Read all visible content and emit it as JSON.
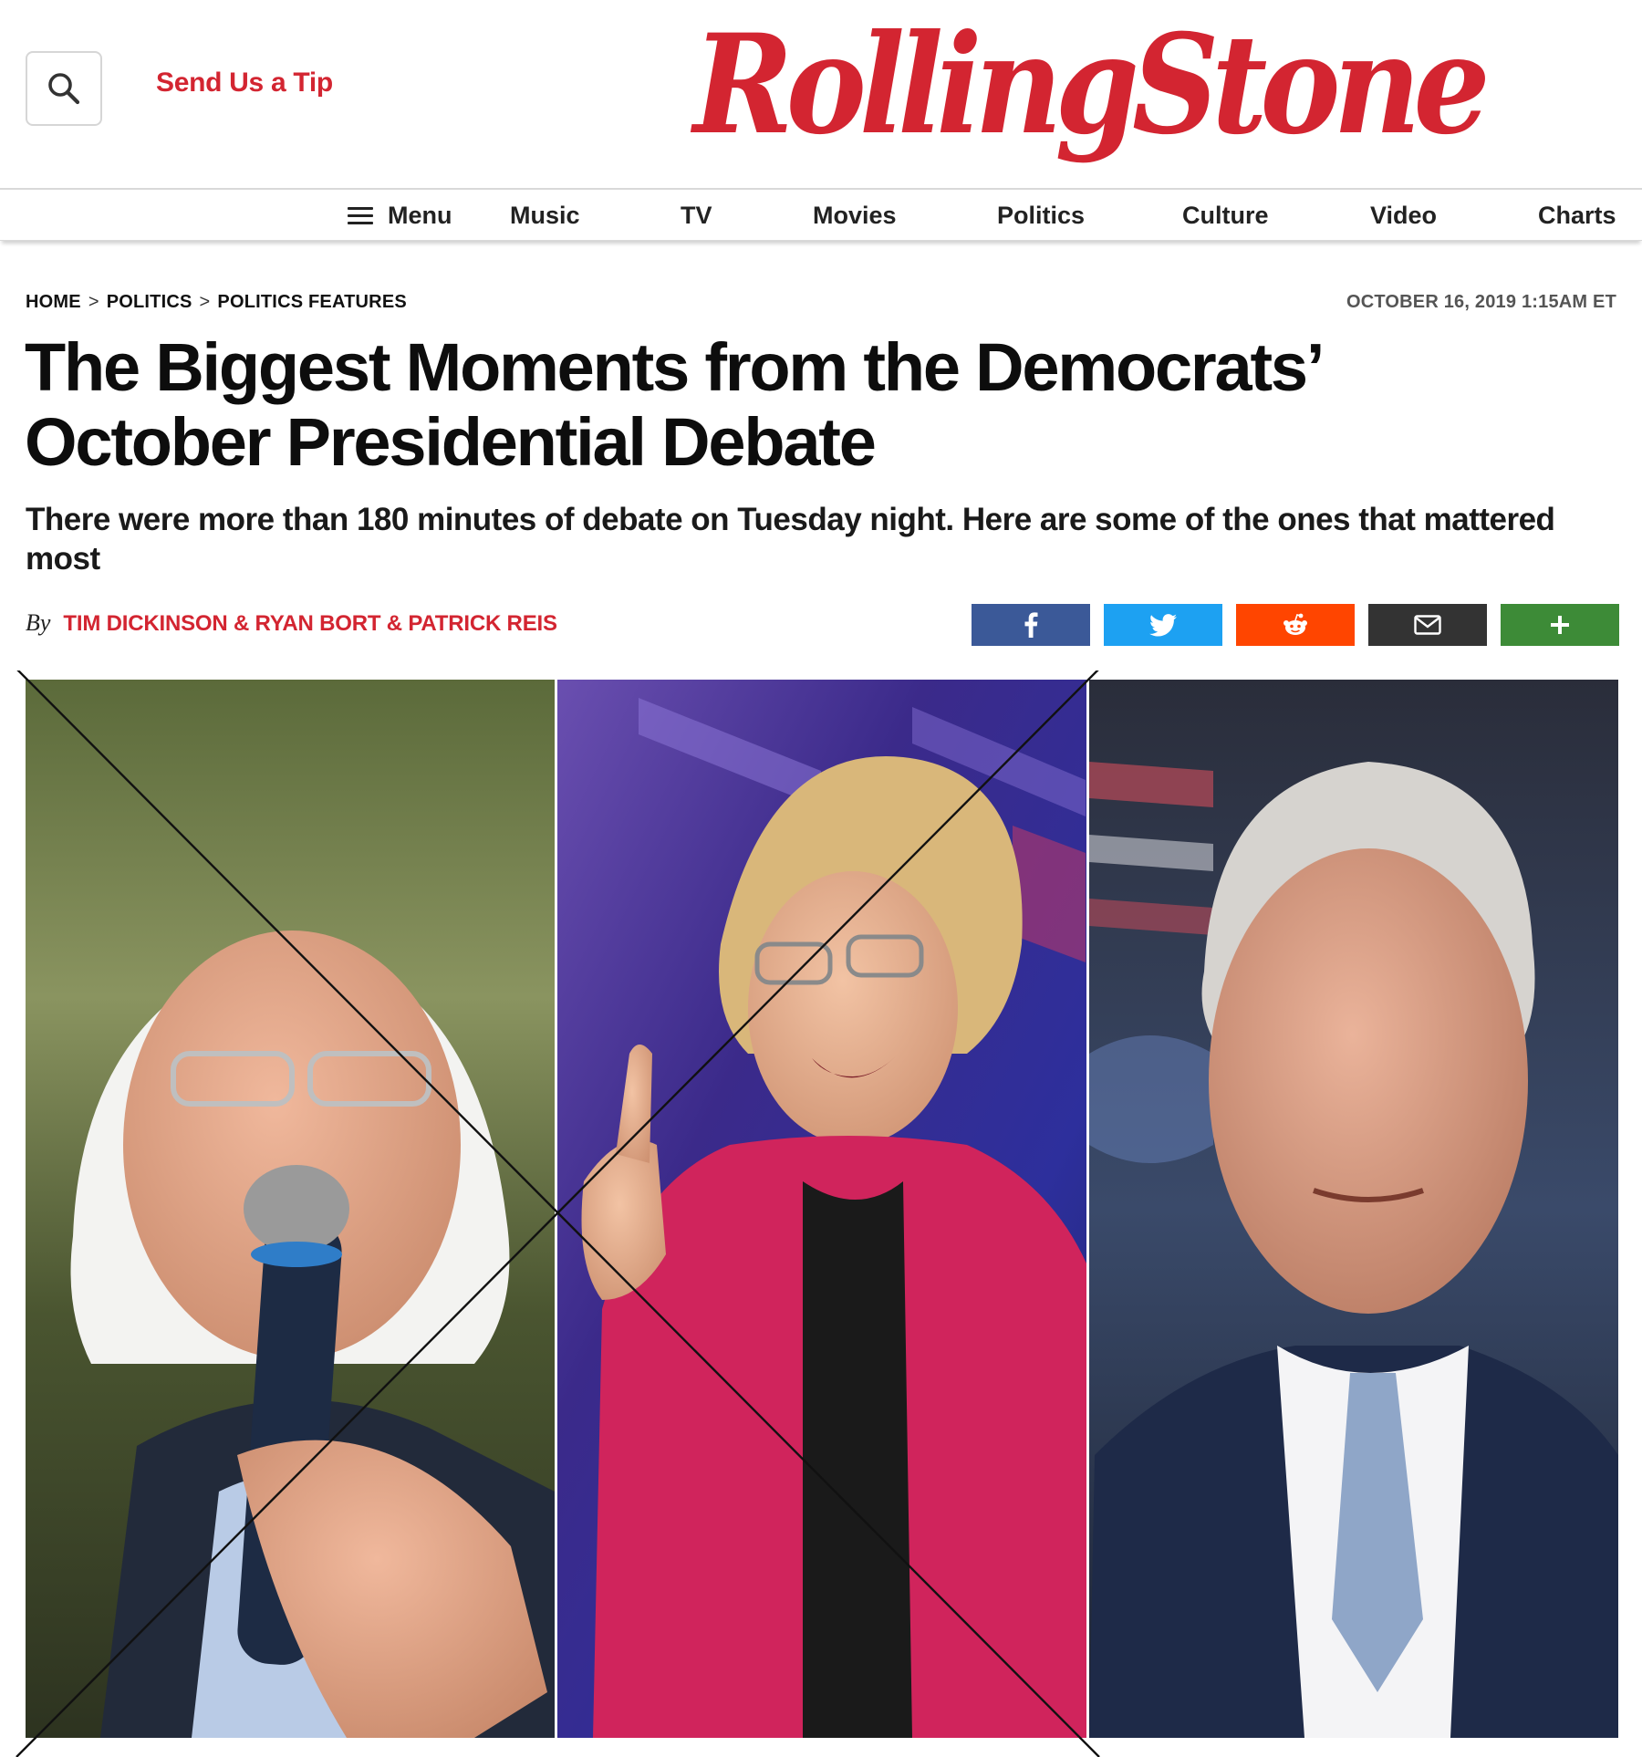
{
  "header": {
    "tip_label": "Send Us a Tip",
    "logo_text": "RollingStone",
    "brand_color": "#d32531"
  },
  "nav": {
    "menu_label": "Menu",
    "items": [
      {
        "label": "Music"
      },
      {
        "label": "TV"
      },
      {
        "label": "Movies"
      },
      {
        "label": "Politics"
      },
      {
        "label": "Culture"
      },
      {
        "label": "Video"
      },
      {
        "label": "Charts"
      }
    ]
  },
  "article": {
    "breadcrumb": [
      "HOME",
      "POLITICS",
      "POLITICS FEATURES"
    ],
    "breadcrumb_separator": ">",
    "date": "OCTOBER 16, 2019 1:15AM ET",
    "headline_line1": "The Biggest Moments from the Democrats’",
    "headline_line2": "October Presidential Debate",
    "dek": "There were more than 180 minutes of debate on Tuesday night. Here are some of the ones that mattered most",
    "byline_prefix": "By",
    "authors": "TIM DICKINSON & RYAN BORT & PATRICK REIS"
  },
  "share": [
    {
      "network": "facebook",
      "icon": "facebook-icon",
      "color": "#3b5998"
    },
    {
      "network": "twitter",
      "icon": "twitter-icon",
      "color": "#1da1f2"
    },
    {
      "network": "reddit",
      "icon": "reddit-icon",
      "color": "#ff4500"
    },
    {
      "network": "email",
      "icon": "email-icon",
      "color": "#333333"
    },
    {
      "network": "more",
      "icon": "plus-icon",
      "color": "#3d8b37"
    }
  ],
  "hero": {
    "panels": [
      "photo-left",
      "photo-center",
      "photo-right"
    ],
    "overlay": "cross-out lines"
  }
}
